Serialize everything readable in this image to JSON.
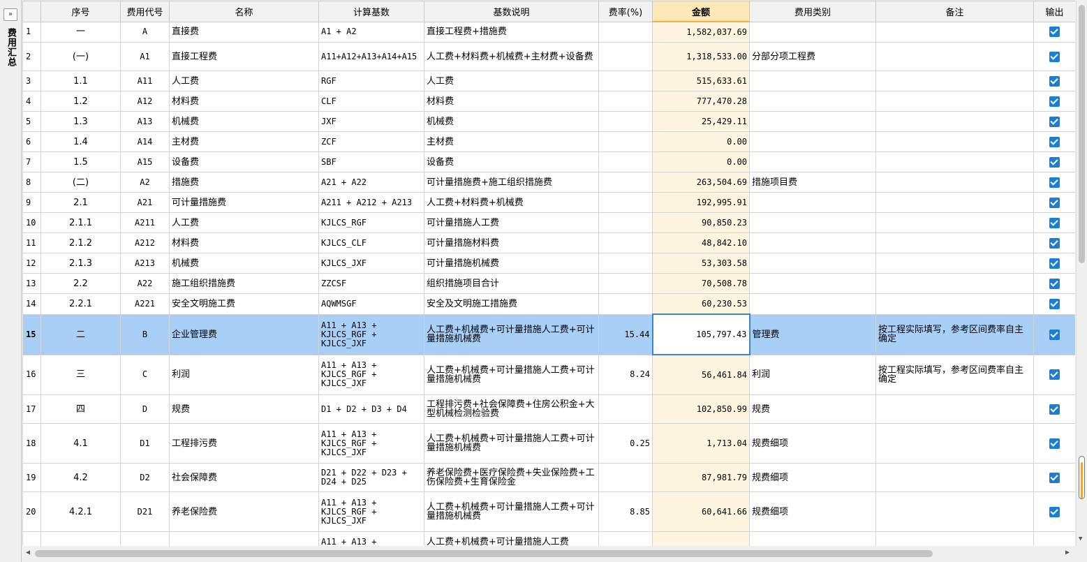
{
  "sidebar": {
    "expand_icon": "»",
    "title": "费用汇总"
  },
  "columns": [
    "",
    "序号",
    "费用代号",
    "名称",
    "计算基数",
    "基数说明",
    "费率(%)",
    "金额",
    "费用类别",
    "备注",
    "输出"
  ],
  "rows": [
    {
      "n": "1",
      "seq": "一",
      "code": "A",
      "name": "直接费",
      "base": "A1 + A2",
      "desc": "直接工程费+措施费",
      "rate": "",
      "amount": "1,582,037.69",
      "category": "",
      "note": "",
      "output": true
    },
    {
      "n": "2",
      "seq": "(一)",
      "code": "A1",
      "name": "直接工程费",
      "base": "A11+A12+A13+A14+A15",
      "desc": "人工费+材料费+机械费+主材费+设备费",
      "rate": "",
      "amount": "1,318,533.00",
      "category": "分部分项工程费",
      "note": "",
      "output": true
    },
    {
      "n": "3",
      "seq": "1.1",
      "code": "A11",
      "name": "人工费",
      "base": "RGF",
      "desc": "人工费",
      "rate": "",
      "amount": "515,633.61",
      "category": "",
      "note": "",
      "output": true
    },
    {
      "n": "4",
      "seq": "1.2",
      "code": "A12",
      "name": "材料费",
      "base": "CLF",
      "desc": "材料费",
      "rate": "",
      "amount": "777,470.28",
      "category": "",
      "note": "",
      "output": true
    },
    {
      "n": "5",
      "seq": "1.3",
      "code": "A13",
      "name": "机械费",
      "base": "JXF",
      "desc": "机械费",
      "rate": "",
      "amount": "25,429.11",
      "category": "",
      "note": "",
      "output": true
    },
    {
      "n": "6",
      "seq": "1.4",
      "code": "A14",
      "name": "主材费",
      "base": "ZCF",
      "desc": "主材费",
      "rate": "",
      "amount": "0.00",
      "category": "",
      "note": "",
      "output": true
    },
    {
      "n": "7",
      "seq": "1.5",
      "code": "A15",
      "name": "设备费",
      "base": "SBF",
      "desc": "设备费",
      "rate": "",
      "amount": "0.00",
      "category": "",
      "note": "",
      "output": true
    },
    {
      "n": "8",
      "seq": "(二)",
      "code": "A2",
      "name": "措施费",
      "base": "A21 + A22",
      "desc": "可计量措施费+施工组织措施费",
      "rate": "",
      "amount": "263,504.69",
      "category": "措施项目费",
      "note": "",
      "output": true
    },
    {
      "n": "9",
      "seq": "2.1",
      "code": "A21",
      "name": "可计量措施费",
      "base": "A211 + A212 + A213",
      "desc": "人工费+材料费+机械费",
      "rate": "",
      "amount": "192,995.91",
      "category": "",
      "note": "",
      "output": true
    },
    {
      "n": "10",
      "seq": "2.1.1",
      "code": "A211",
      "name": "人工费",
      "base": "KJLCS_RGF",
      "desc": "可计量措施人工费",
      "rate": "",
      "amount": "90,850.23",
      "category": "",
      "note": "",
      "output": true
    },
    {
      "n": "11",
      "seq": "2.1.2",
      "code": "A212",
      "name": "材料费",
      "base": "KJLCS_CLF",
      "desc": "可计量措施材料费",
      "rate": "",
      "amount": "48,842.10",
      "category": "",
      "note": "",
      "output": true
    },
    {
      "n": "12",
      "seq": "2.1.3",
      "code": "A213",
      "name": "机械费",
      "base": "KJLCS_JXF",
      "desc": "可计量措施机械费",
      "rate": "",
      "amount": "53,303.58",
      "category": "",
      "note": "",
      "output": true
    },
    {
      "n": "13",
      "seq": "2.2",
      "code": "A22",
      "name": "施工组织措施费",
      "base": "ZZCSF",
      "desc": "组织措施项目合计",
      "rate": "",
      "amount": "70,508.78",
      "category": "",
      "note": "",
      "output": true
    },
    {
      "n": "14",
      "seq": "2.2.1",
      "code": "A221",
      "name": "安全文明施工费",
      "base": "AQWMSGF",
      "desc": "安全及文明施工措施费",
      "rate": "",
      "amount": "60,230.53",
      "category": "",
      "note": "",
      "output": true
    },
    {
      "n": "15",
      "seq": "二",
      "code": "B",
      "name": "企业管理费",
      "base": "A11 + A13 + KJLCS_RGF + KJLCS_JXF",
      "desc": "人工费+机械费+可计量措施人工费+可计量措施机械费",
      "rate": "15.44",
      "amount": "105,797.43",
      "category": "管理费",
      "note": "按工程实际填写，参考区间费率自主确定",
      "output": true
    },
    {
      "n": "16",
      "seq": "三",
      "code": "C",
      "name": "利润",
      "base": "A11 + A13 + KJLCS_RGF + KJLCS_JXF",
      "desc": "人工费+机械费+可计量措施人工费+可计量措施机械费",
      "rate": "8.24",
      "amount": "56,461.84",
      "category": "利润",
      "note": "按工程实际填写，参考区间费率自主确定",
      "output": true
    },
    {
      "n": "17",
      "seq": "四",
      "code": "D",
      "name": "规费",
      "base": "D1 + D2 + D3 + D4",
      "desc": "工程排污费+社会保障费+住房公积金+大型机械检测检验费",
      "rate": "",
      "amount": "102,850.99",
      "category": "规费",
      "note": "",
      "output": true
    },
    {
      "n": "18",
      "seq": "4.1",
      "code": "D1",
      "name": "工程排污费",
      "base": "A11 + A13 + KJLCS_RGF + KJLCS_JXF",
      "desc": "人工费+机械费+可计量措施人工费+可计量措施机械费",
      "rate": "0.25",
      "amount": "1,713.04",
      "category": "规费细项",
      "note": "",
      "output": true
    },
    {
      "n": "19",
      "seq": "4.2",
      "code": "D2",
      "name": "社会保障费",
      "base": "D21 + D22 + D23 + D24 + D25",
      "desc": "养老保险费+医疗保险费+失业保险费+工伤保险费+生育保险金",
      "rate": "",
      "amount": "87,981.79",
      "category": "规费细项",
      "note": "",
      "output": true
    },
    {
      "n": "20",
      "seq": "4.2.1",
      "code": "D21",
      "name": "养老保险费",
      "base": "A11 + A13 + KJLCS_RGF + KJLCS_JXF",
      "desc": "人工费+机械费+可计量措施人工费+可计量措施机械费",
      "rate": "8.85",
      "amount": "60,641.66",
      "category": "规费细项",
      "note": "",
      "output": true
    },
    {
      "n": "",
      "seq": "",
      "code": "",
      "name": "",
      "base": "A11 + A13 +",
      "desc": "人工费+机械费+可计量措施人工费",
      "rate": "",
      "amount": "",
      "category": "",
      "note": "",
      "output": false
    }
  ],
  "selected_row": "15"
}
